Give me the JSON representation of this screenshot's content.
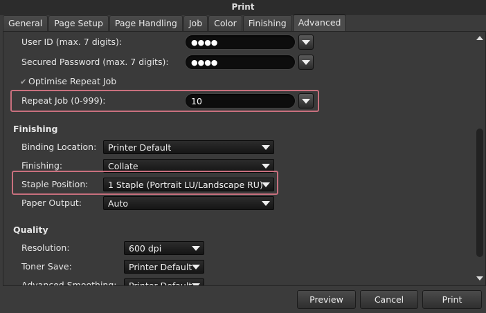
{
  "window": {
    "title": "Print"
  },
  "tabs": [
    "General",
    "Page Setup",
    "Page Handling",
    "Job",
    "Color",
    "Finishing",
    "Advanced"
  ],
  "active_tab": "Advanced",
  "job": {
    "user_id_label": "User ID (max. 7 digits):",
    "user_id_value": "●●●●",
    "password_label": "Secured Password (max. 7 digits):",
    "password_value": "●●●●",
    "optimise_label": "Optimise Repeat Job",
    "repeat_label": "Repeat Job (0-999):",
    "repeat_value": "10"
  },
  "finishing": {
    "heading": "Finishing",
    "binding_label": "Binding Location:",
    "binding_value": "Printer Default",
    "finishing_label": "Finishing:",
    "finishing_value": "Collate",
    "staple_label": "Staple Position:",
    "staple_value": "1 Staple (Portrait LU/Landscape RU)",
    "output_label": "Paper Output:",
    "output_value": "Auto"
  },
  "quality": {
    "heading": "Quality",
    "resolution_label": "Resolution:",
    "resolution_value": "600 dpi",
    "toner_label": "Toner Save:",
    "toner_value": "Printer Default",
    "smoothing_label": "Advanced Smoothing:",
    "smoothing_value": "Printer Default"
  },
  "buttons": {
    "preview": "Preview",
    "cancel": "Cancel",
    "print": "Print"
  }
}
